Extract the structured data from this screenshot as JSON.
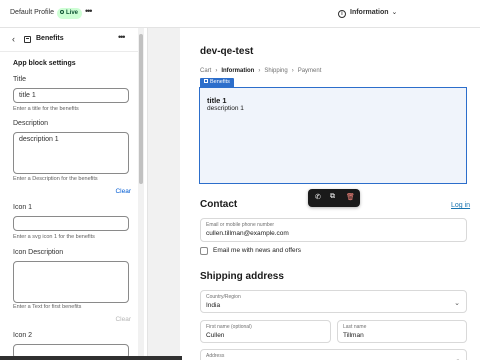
{
  "topbar": {
    "profile": "Default Profile",
    "live_badge": "Live",
    "more_icon": "ellipsis-icon",
    "page_selector": "Information"
  },
  "sidebar": {
    "back_icon": "chevron-left-icon",
    "block_icon": "app-block-icon",
    "title": "Benefits",
    "settings_title": "App block settings",
    "fields": {
      "title": {
        "label": "Title",
        "value": "title 1",
        "help": "Enter a title for the benefits"
      },
      "description": {
        "label": "Description",
        "value": "description 1",
        "help": "Enter a Description for the benefits",
        "clear": "Clear"
      },
      "icon1": {
        "label": "Icon 1",
        "value": "",
        "help": "Enter a svg icon 1 for the benefits"
      },
      "icon_description": {
        "label": "Icon Description",
        "value": "",
        "help": "Enter a Text for first benefits",
        "clear": "Clear"
      },
      "icon2": {
        "label": "Icon 2",
        "value": ""
      }
    }
  },
  "preview": {
    "store_name": "dev-qe-test",
    "breadcrumbs": [
      "Cart",
      "Information",
      "Shipping",
      "Payment"
    ],
    "block_tag": "Benefits",
    "benefit_title": "title 1",
    "benefit_description": "description 1",
    "contact": {
      "heading": "Contact",
      "login": "Log in",
      "email_label": "Email or mobile phone number",
      "email_value": "cullen.tillman@example.com",
      "newsletter": "Email me with news and offers"
    },
    "shipping": {
      "heading": "Shipping address",
      "country_label": "Country/Region",
      "country_value": "India",
      "first_name_label": "First name (optional)",
      "first_name_value": "Cullen",
      "last_name_label": "Last name",
      "last_name_value": "Tillman",
      "address_label": "Address"
    }
  },
  "colors": {
    "accent": "#2c6ecb",
    "link": "#005bd3",
    "live_bg": "#cdfed4"
  }
}
